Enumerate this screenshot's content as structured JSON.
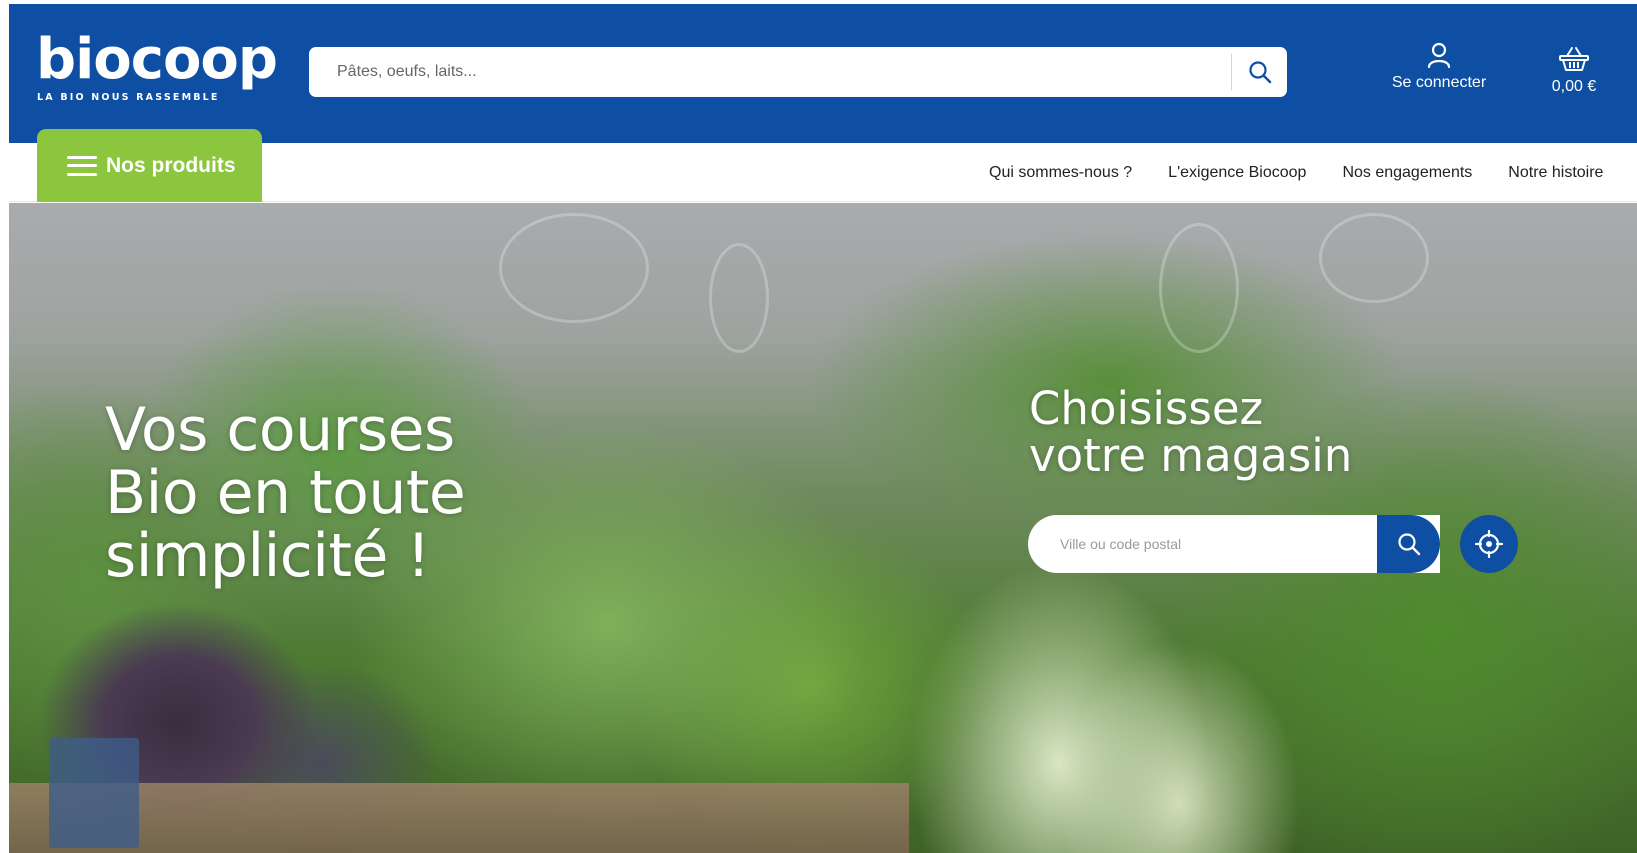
{
  "header": {
    "logo": {
      "word": "biocoop",
      "tagline": "LA BIO NOUS RASSEMBLE"
    },
    "search": {
      "placeholder": "Pâtes, oeufs, laits..."
    },
    "account": {
      "label": "Se connecter",
      "icon": "user-icon"
    },
    "cart": {
      "total": "0,00 €",
      "icon": "basket-icon"
    }
  },
  "nav": {
    "products_label": "Nos produits",
    "links": [
      "Qui sommes-nous ?",
      "L'exigence Biocoop",
      "Nos engagements",
      "Notre histoire"
    ]
  },
  "hero": {
    "title_lines": [
      "Vos courses",
      "Bio en toute",
      "simplicité !"
    ],
    "store_title_lines": [
      "Choisissez",
      "votre magasin"
    ],
    "store_search_placeholder": "Ville ou code postal"
  },
  "colors": {
    "brand_blue": "#0e4fa3",
    "brand_green": "#8cc63e"
  }
}
